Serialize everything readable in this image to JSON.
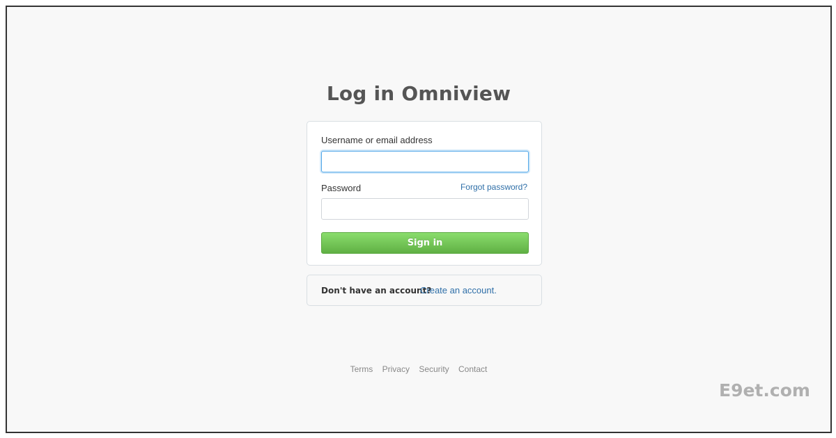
{
  "page": {
    "title": "Log in Omniview"
  },
  "form": {
    "username_label": "Username or email address",
    "username_value": "",
    "password_label": "Password",
    "password_value": "",
    "forgot_link": "Forgot password?",
    "signin_label": "Sign in"
  },
  "signup": {
    "prompt": "Don't have an account?",
    "link": "Create an account."
  },
  "footer": {
    "links": [
      "Terms",
      "Privacy",
      "Security",
      "Contact"
    ]
  },
  "watermark": "E9et.com",
  "colors": {
    "accent_link": "#2f6fa8",
    "signin_green": "#60b044",
    "focus_blue": "#51a7e8"
  }
}
